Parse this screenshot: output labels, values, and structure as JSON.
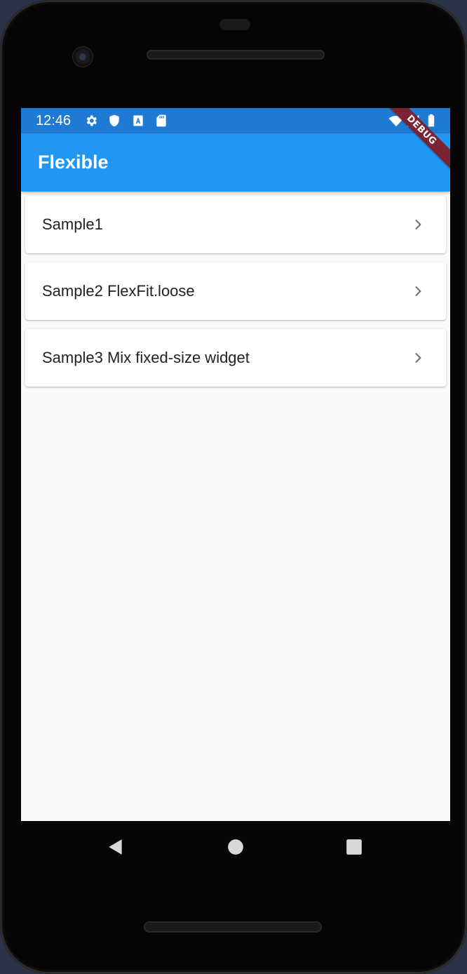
{
  "status_bar": {
    "time": "12:46",
    "icons": [
      "settings-icon",
      "shield-icon",
      "font-a-icon",
      "sd-card-icon",
      "wifi-icon",
      "signal-icon",
      "battery-icon"
    ]
  },
  "app_bar": {
    "title": "Flexible",
    "debug_banner": "DEBUG",
    "color": "#2196f3"
  },
  "list": {
    "items": [
      {
        "label": "Sample1",
        "icon": "chevron-right-icon"
      },
      {
        "label": "Sample2 FlexFit.loose",
        "icon": "chevron-right-icon"
      },
      {
        "label": "Sample3 Mix fixed-size widget",
        "icon": "chevron-right-icon"
      }
    ]
  },
  "nav_bar": {
    "buttons": [
      "back-icon",
      "home-icon",
      "recents-icon"
    ]
  }
}
